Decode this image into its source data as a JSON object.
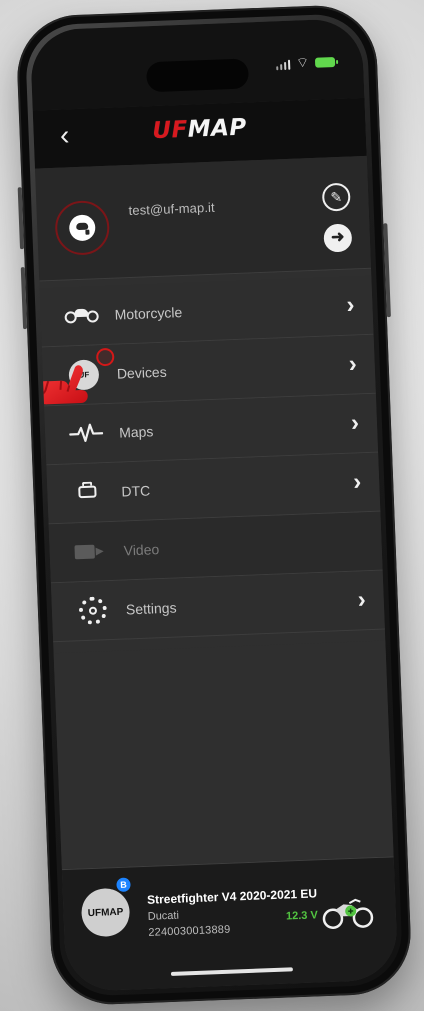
{
  "header": {
    "back_label": "‹",
    "logo_left": "UF",
    "logo_right": "MAP"
  },
  "profile": {
    "email": "test@uf-map.it",
    "edit_icon": "✎",
    "logout_icon": "➜"
  },
  "menu": {
    "items": [
      {
        "label": "Motorcycle",
        "icon": "motorcycle-icon",
        "chevron": "›"
      },
      {
        "label": "Devices",
        "icon": "device-icon",
        "chevron": "›"
      },
      {
        "label": "Maps",
        "icon": "maps-icon",
        "chevron": "›"
      },
      {
        "label": "DTC",
        "icon": "dtc-icon",
        "chevron": "›"
      },
      {
        "label": "Video",
        "icon": "video-icon"
      },
      {
        "label": "Settings",
        "icon": "settings-icon",
        "chevron": "›"
      }
    ]
  },
  "device_card": {
    "logo": "UFMAP",
    "bluetooth_icon": "B",
    "title": "Streetfighter V4 2020-2021 EU",
    "brand": "Ducati",
    "serial": "2240030013889",
    "voltage": "12.3 V"
  },
  "colors": {
    "accent_red": "#d31818",
    "success_green": "#52c441",
    "panel_dark": "#1b1b1b"
  }
}
